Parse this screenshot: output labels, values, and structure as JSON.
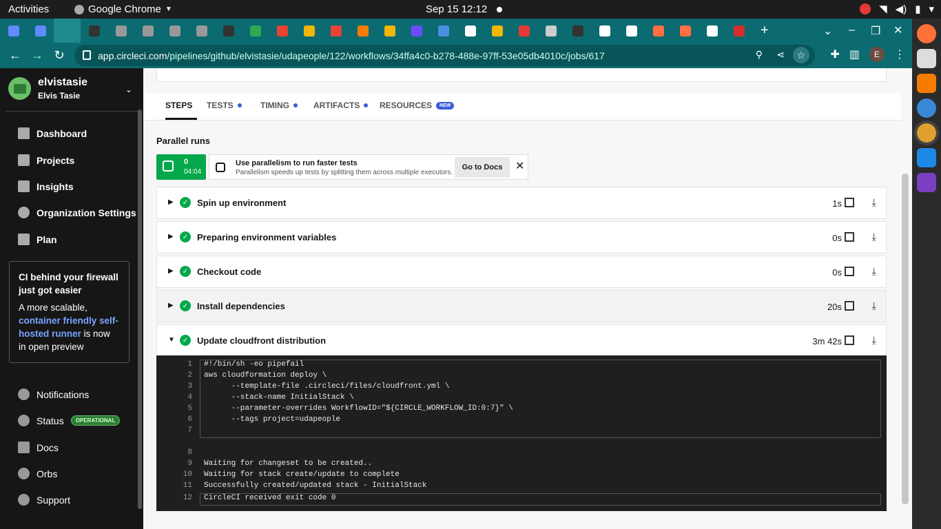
{
  "system": {
    "activities": "Activities",
    "app_name": "Google Chrome",
    "clock": "Sep 15  12:12"
  },
  "browser": {
    "url_host": "app.circleci.com",
    "url_path": "/pipelines/github/elvistasie/udapeople/122/workflows/34ffa4c0-b278-488e-97ff-53e05db4010c/jobs/617",
    "profile_initial": "E",
    "tab_colors": [
      "#5f8bff",
      "#5f8bff",
      "#1e8a8f",
      "#333333",
      "#999999",
      "#999999",
      "#999999",
      "#999999",
      "#333333",
      "#2da94f",
      "#ea4335",
      "#f2b705",
      "#ea4335",
      "#f57c00",
      "#f2b705",
      "#6a4cff",
      "#4a90e2",
      "#ffffff",
      "#f2b705",
      "#e53935",
      "#cccccc",
      "#333333",
      "#ffffff",
      "#ffffff",
      "#ff7043",
      "#ff7043",
      "#ffffff",
      "#d32f2f"
    ]
  },
  "sidebar": {
    "org_name": "elvistasie",
    "org_user": "Elvis Tasie",
    "nav": [
      {
        "label": "Dashboard",
        "icon": "dashboard-icon"
      },
      {
        "label": "Projects",
        "icon": "projects-icon"
      },
      {
        "label": "Insights",
        "icon": "insights-icon"
      },
      {
        "label": "Organization Settings",
        "icon": "gear-icon"
      },
      {
        "label": "Plan",
        "icon": "dollar-icon"
      }
    ],
    "promo": {
      "title": "CI behind your firewall just got easier",
      "text_before": "A more scalable, ",
      "link": "container friendly self-hosted runner",
      "text_after": " is now in open preview"
    },
    "lower": [
      {
        "label": "Notifications",
        "icon": "bell-icon"
      },
      {
        "label": "Status",
        "icon": "status-icon",
        "badge": "OPERATIONAL"
      },
      {
        "label": "Docs",
        "icon": "docs-icon"
      },
      {
        "label": "Orbs",
        "icon": "orbs-icon"
      },
      {
        "label": "Support",
        "icon": "support-icon"
      }
    ]
  },
  "tabs": [
    {
      "label": "STEPS",
      "selected": true
    },
    {
      "label": "TESTS",
      "dot": true
    },
    {
      "label": "TIMING",
      "dot": true
    },
    {
      "label": "ARTIFACTS",
      "dot": true
    },
    {
      "label": "RESOURCES",
      "badge": "NEW"
    }
  ],
  "parallel": {
    "title": "Parallel runs",
    "run_index": "0",
    "run_time": "04:04",
    "tip_title": "Use parallelism to run faster tests",
    "tip_sub": "Parallelism speeds up tests by splitting them across multiple executors.",
    "docs_button": "Go to Docs"
  },
  "steps": [
    {
      "name": "Spin up environment",
      "duration": "1s"
    },
    {
      "name": "Preparing environment variables",
      "duration": "0s"
    },
    {
      "name": "Checkout code",
      "duration": "0s"
    },
    {
      "name": "Install dependencies",
      "duration": "20s"
    },
    {
      "name": "Update cloudfront distribution",
      "duration": "3m 42s",
      "expanded": true
    }
  ],
  "console": [
    {
      "n": "1",
      "t": "#!/bin/sh -eo pipefail"
    },
    {
      "n": "2",
      "t": "aws cloudformation deploy \\"
    },
    {
      "n": "3",
      "t": "      --template-file .circleci/files/cloudfront.yml \\"
    },
    {
      "n": "4",
      "t": "      --stack-name InitialStack \\"
    },
    {
      "n": "5",
      "t": "      --parameter-overrides WorkflowID=\"${CIRCLE_WORKFLOW_ID:0:7}\" \\"
    },
    {
      "n": "6",
      "t": "      --tags project=udapeople"
    },
    {
      "n": "7",
      "t": ""
    },
    {
      "n": "8",
      "t": ""
    },
    {
      "n": "9",
      "t": "Waiting for changeset to be created.."
    },
    {
      "n": "10",
      "t": "Waiting for stack create/update to complete"
    },
    {
      "n": "11",
      "t": "Successfully created/updated stack - InitialStack"
    },
    {
      "n": "12",
      "t": "CircleCI received exit code 0"
    }
  ]
}
